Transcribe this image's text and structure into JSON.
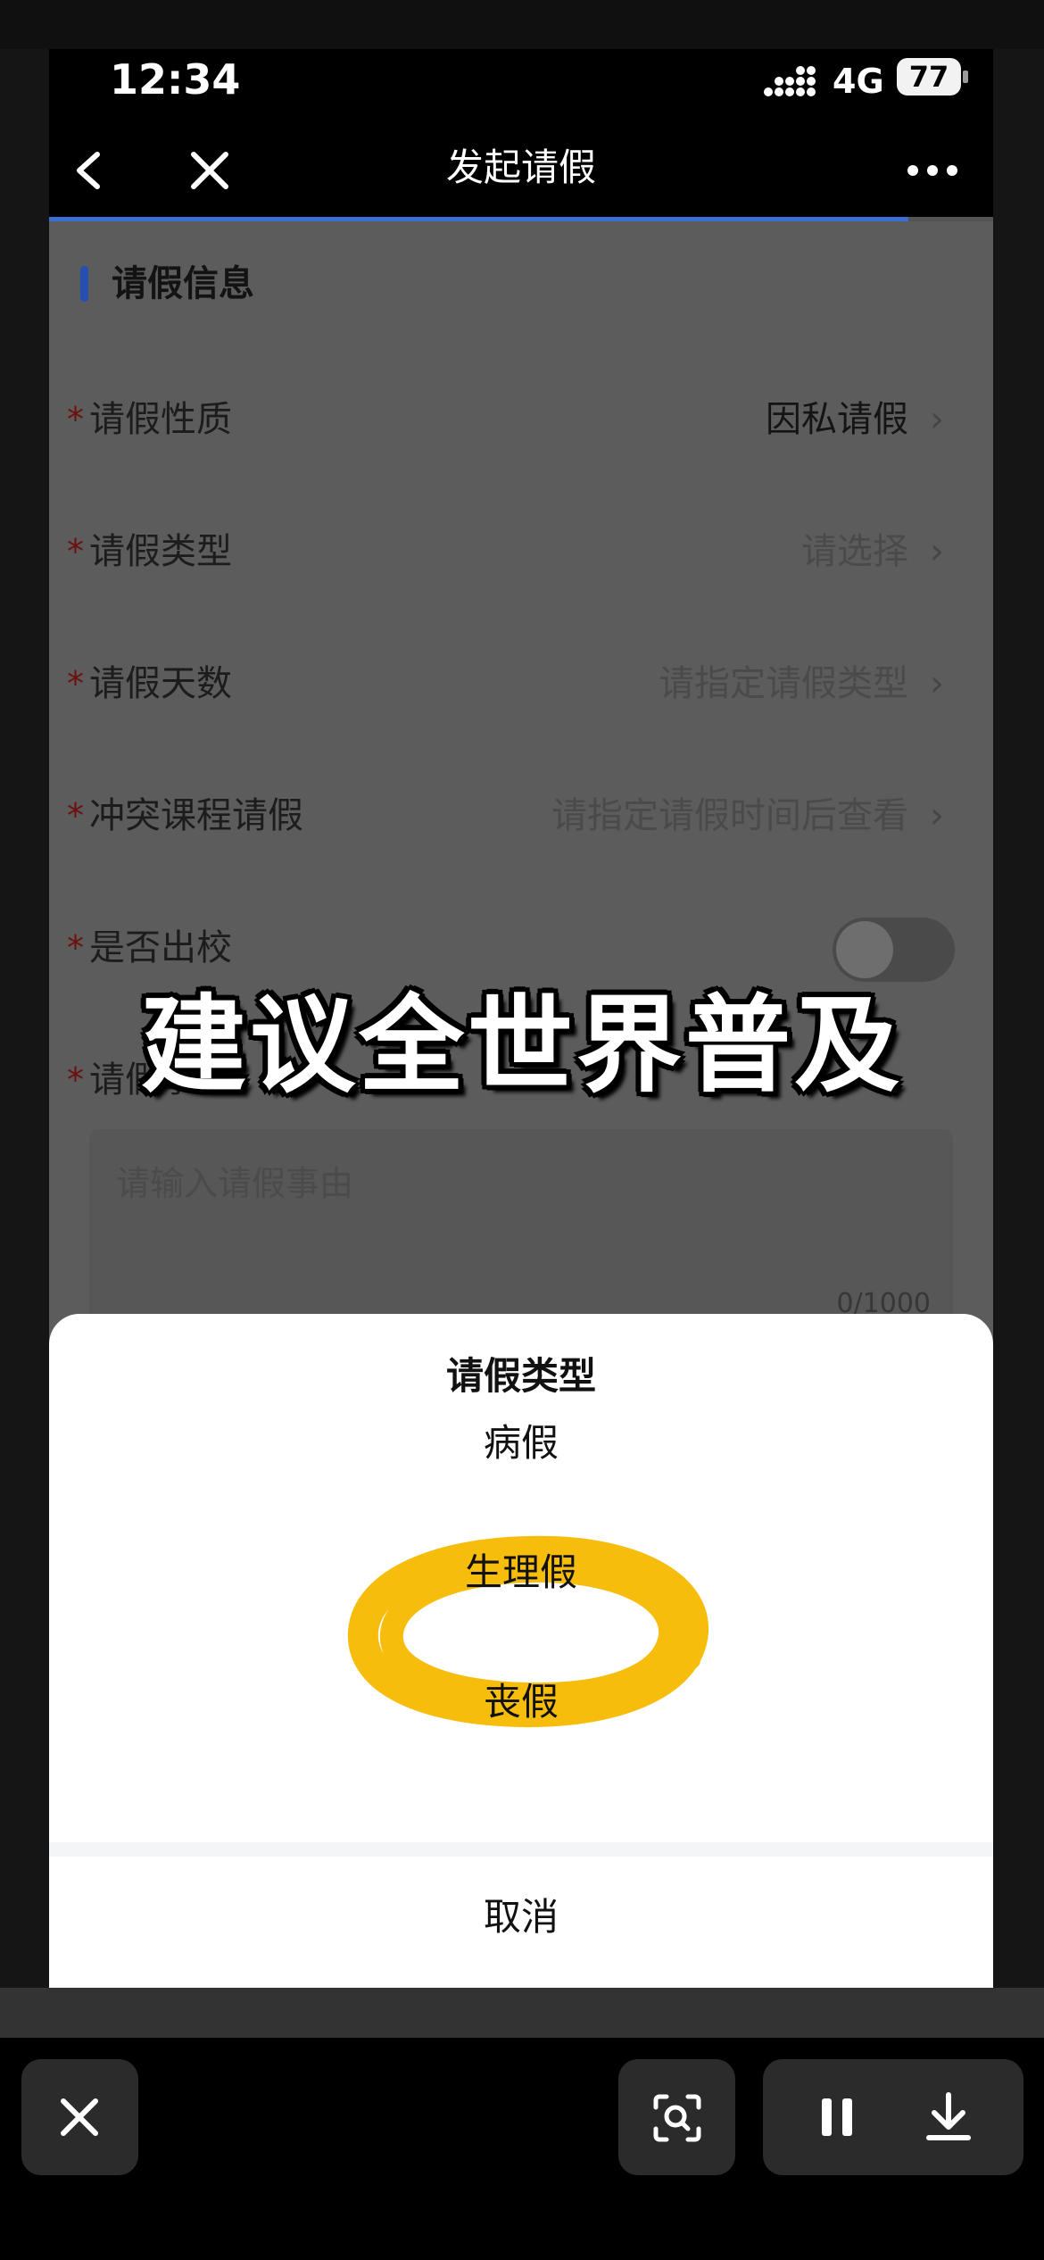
{
  "status_bar": {
    "time": "12:34",
    "network": "4G",
    "battery": "77"
  },
  "nav": {
    "title": "发起请假",
    "progress_fraction": 0.91
  },
  "form": {
    "section_title": "请假信息",
    "required_mark": "*",
    "rows": [
      {
        "label": "请假性质",
        "value": "因私请假"
      },
      {
        "label": "请假类型",
        "value": "请选择"
      },
      {
        "label": "请假天数",
        "value": "请指定请假类型"
      },
      {
        "label": "冲突课程请假",
        "value": "请指定请假时间后查看"
      },
      {
        "label": "是否出校",
        "value": ""
      },
      {
        "label": "请假事由",
        "value": ""
      }
    ],
    "reason_placeholder": "请输入请假事由",
    "reason_counter": "0/1000",
    "leave_school_toggle": "off"
  },
  "caption": "建议全世界普及",
  "sheet": {
    "title": "请假类型",
    "options": [
      "病假",
      "生理假",
      "丧假"
    ],
    "highlighted_option": "生理假",
    "cancel_label": "取消"
  },
  "colors": {
    "accent_blue": "#3a6fd4",
    "highlight_yellow": "#f7bd0d",
    "required_red": "#e02020"
  }
}
